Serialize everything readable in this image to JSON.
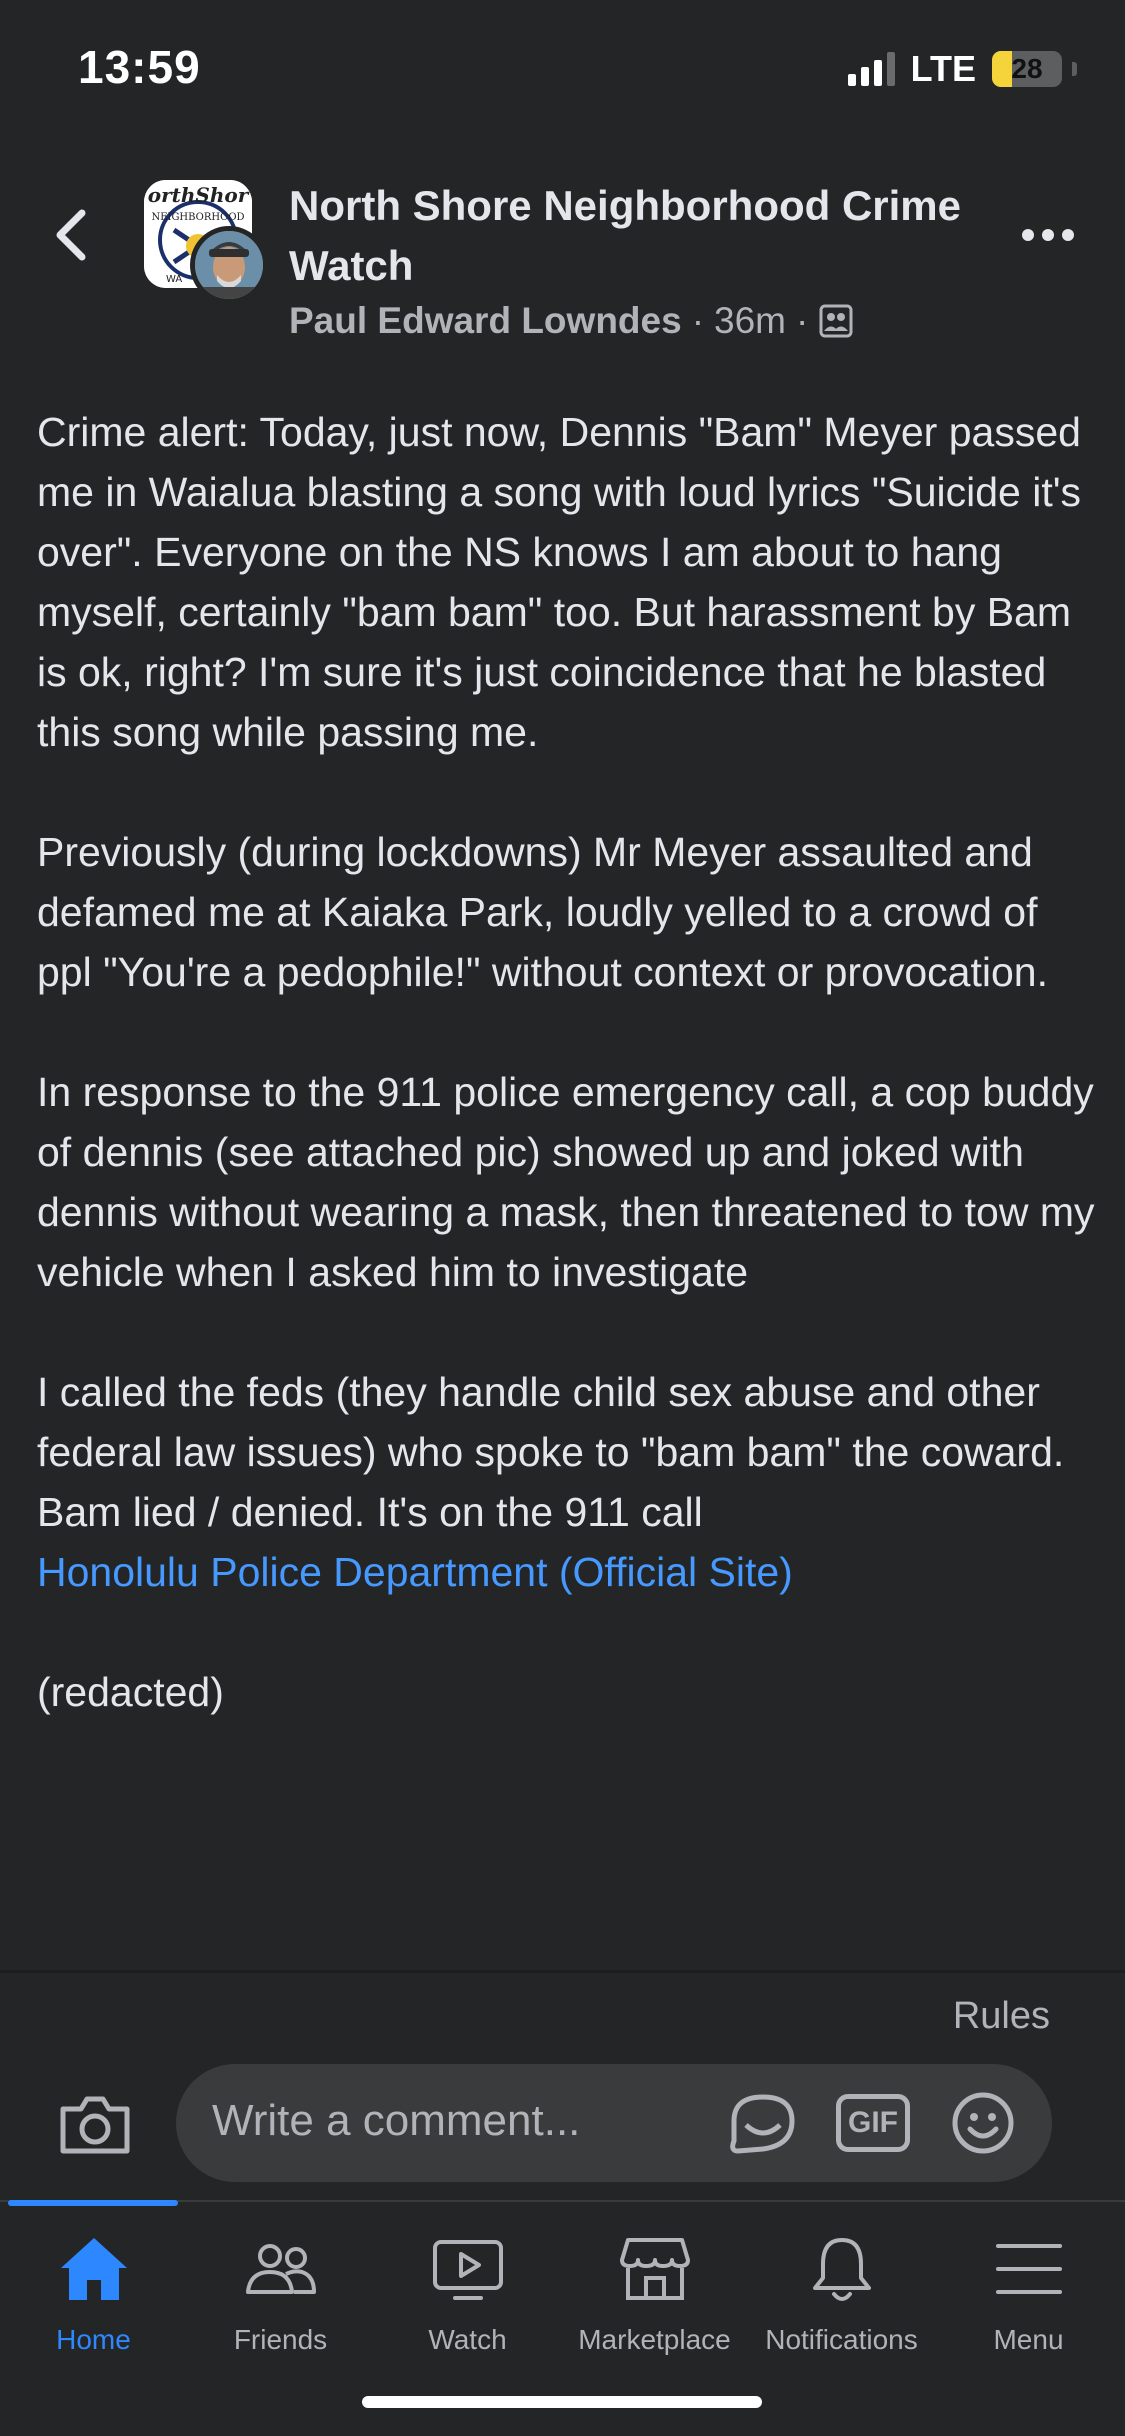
{
  "status_bar": {
    "time": "13:59",
    "network": "LTE",
    "battery_percent": "28",
    "battery_level": 0.28,
    "signal_bars_active": 3,
    "signal_bars_total": 4
  },
  "header": {
    "group_name": "North Shore Neighborhood Crime Watch",
    "author": "Paul Edward Lowndes",
    "separator": "·",
    "time_ago": "36m",
    "audience_icon": "group-members-icon",
    "group_logo_text_top": "orthShor",
    "group_logo_text_mid": "NEIGHBORHOOD",
    "group_logo_text_bottom": "WA"
  },
  "post": {
    "paragraphs": [
      "Crime alert: Today, just now, Dennis \"Bam\" Meyer passed me in Waialua blasting a song with loud lyrics \"Suicide it's over\". Everyone on the NS knows I am about to hang myself, certainly \"bam bam\" too. But harassment by Bam is ok, right? I'm sure it's just coincidence that he blasted this song while passing me.",
      "Previously (during lockdowns) Mr Meyer assaulted and defamed me at Kaiaka Park, loudly yelled to a crowd of ppl \"You're a pedophile!\" without context or provocation.",
      "In response to the 911 police emergency call, a cop buddy of dennis (see attached pic) showed up and joked with dennis without wearing a mask, then threatened to tow my vehicle when I asked him to investigate",
      "I called the feds (they handle child sex abuse and other federal law issues) who spoke to \"bam bam\" the coward. Bam lied / denied. It's on the 911 call"
    ],
    "link_text": "Honolulu Police Department (Official Site)",
    "footer_text": "(redacted)"
  },
  "comments": {
    "rules_label": "Rules",
    "placeholder": "Write a comment...",
    "gif_label": "GIF"
  },
  "tabs": [
    {
      "label": "Home",
      "icon": "home-icon",
      "active": true
    },
    {
      "label": "Friends",
      "icon": "friends-icon",
      "active": false
    },
    {
      "label": "Watch",
      "icon": "watch-icon",
      "active": false
    },
    {
      "label": "Marketplace",
      "icon": "marketplace-icon",
      "active": false
    },
    {
      "label": "Notifications",
      "icon": "bell-icon",
      "active": false
    },
    {
      "label": "Menu",
      "icon": "menu-icon",
      "active": false
    }
  ],
  "colors": {
    "background": "#242526",
    "text": "#e4e6eb",
    "secondary_text": "#b0b3b8",
    "link": "#4599ff",
    "accent": "#2d88ff",
    "battery": "#f5d33b"
  }
}
